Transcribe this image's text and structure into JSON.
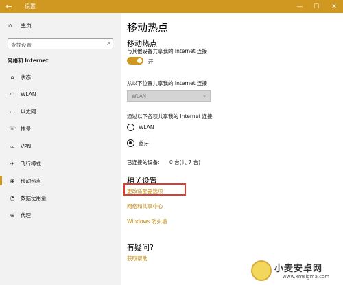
{
  "window": {
    "title": "设置"
  },
  "sidebar": {
    "home_label": "主页",
    "search_placeholder": "查找设置",
    "section_title": "网络和 Internet",
    "items": [
      {
        "label": "状态",
        "icon": "status-icon"
      },
      {
        "label": "WLAN",
        "icon": "wifi-icon"
      },
      {
        "label": "以太网",
        "icon": "ethernet-icon"
      },
      {
        "label": "拨号",
        "icon": "dialup-icon"
      },
      {
        "label": "VPN",
        "icon": "vpn-icon"
      },
      {
        "label": "飞行模式",
        "icon": "airplane-icon"
      },
      {
        "label": "移动热点",
        "icon": "hotspot-icon",
        "active": true
      },
      {
        "label": "数据使用量",
        "icon": "data-usage-icon"
      },
      {
        "label": "代理",
        "icon": "globe-icon"
      }
    ]
  },
  "main": {
    "page_title": "移动热点",
    "hotspot": {
      "heading": "移动热点",
      "share_label": "与其他设备共享我的 Internet 连接",
      "toggle_state": "开"
    },
    "share_from": {
      "label": "从以下位置共享我的 Internet 连接",
      "selected": "WLAN"
    },
    "share_over": {
      "label": "通过以下各项共享我的 Internet 连接",
      "options": [
        {
          "label": "WLAN",
          "checked": false
        },
        {
          "label": "蓝牙",
          "checked": true
        }
      ]
    },
    "connected": {
      "label": "已连接的设备:",
      "value": "0 台(共 7 台)"
    },
    "related": {
      "heading": "相关设置",
      "links": [
        "更改适配器选项",
        "网络和共享中心",
        "Windows 防火墙"
      ]
    },
    "help": {
      "heading": "有疑问?",
      "link": "获取帮助"
    }
  },
  "watermark": {
    "title": "小麦安卓网",
    "url": "www.xmsigma.com"
  },
  "accent_color": "#d09820"
}
